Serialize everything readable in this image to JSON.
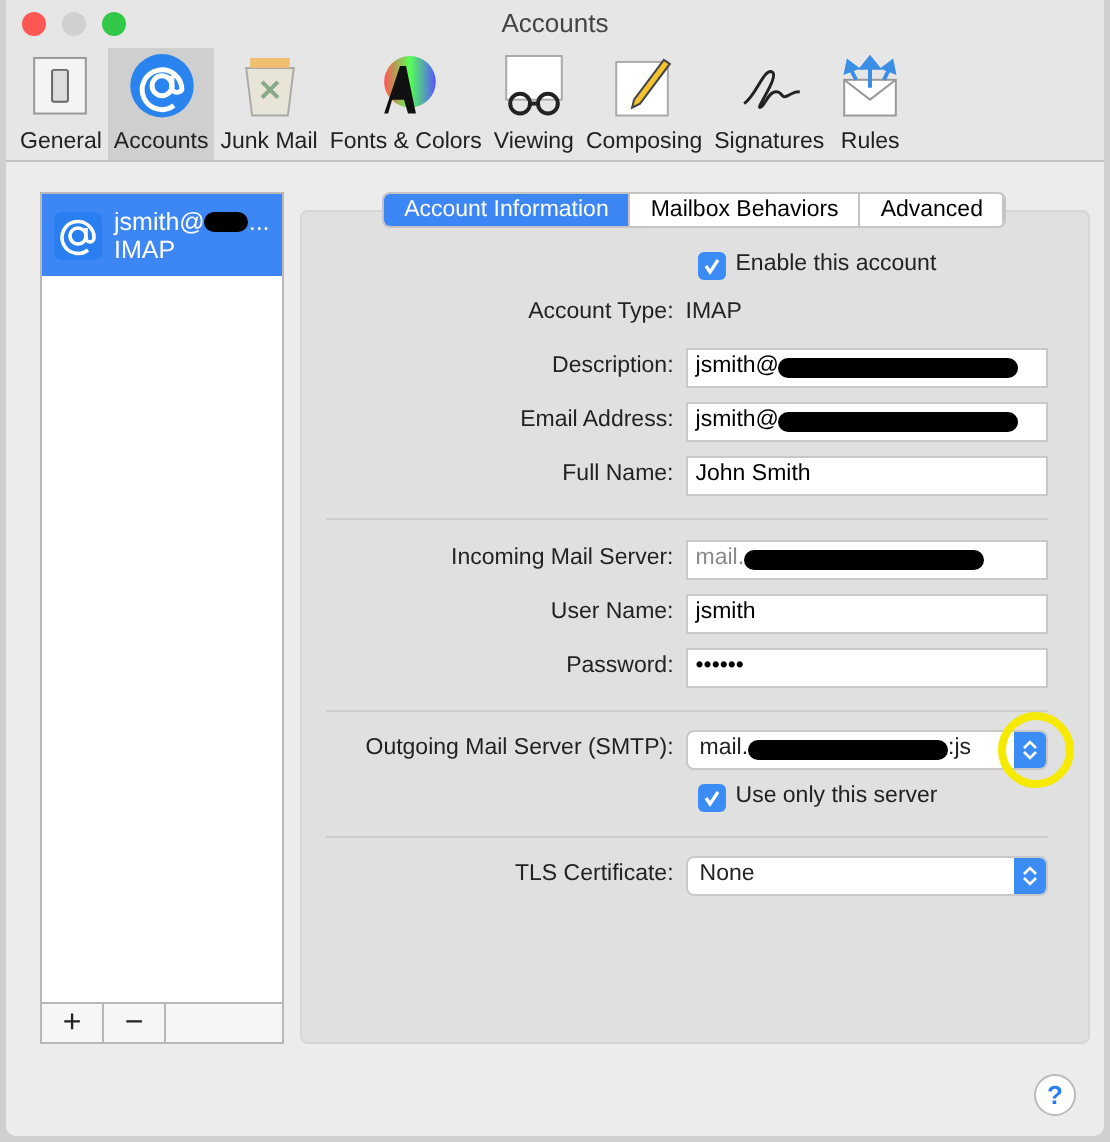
{
  "window": {
    "title": "Accounts"
  },
  "toolbar": [
    {
      "label": "General",
      "kind": "general",
      "selected": false
    },
    {
      "label": "Accounts",
      "kind": "accounts",
      "selected": true
    },
    {
      "label": "Junk Mail",
      "kind": "junk",
      "selected": false
    },
    {
      "label": "Fonts & Colors",
      "kind": "fonts",
      "selected": false
    },
    {
      "label": "Viewing",
      "kind": "viewing",
      "selected": false
    },
    {
      "label": "Composing",
      "kind": "composing",
      "selected": false
    },
    {
      "label": "Signatures",
      "kind": "signatures",
      "selected": false
    },
    {
      "label": "Rules",
      "kind": "rules",
      "selected": false
    }
  ],
  "accounts": [
    {
      "name": "jsmith@",
      "redacted": true,
      "ellipsis": "...",
      "type": "IMAP",
      "selected": true
    }
  ],
  "list_buttons": [
    "+",
    "−"
  ],
  "tabs": [
    {
      "label": "Account Information",
      "selected": true
    },
    {
      "label": "Mailbox Behaviors",
      "selected": false
    },
    {
      "label": "Advanced",
      "selected": false
    }
  ],
  "sections": [
    [
      {
        "kind": "checkbox",
        "label": "Enable this account",
        "checked": true
      },
      {
        "kind": "static",
        "label": "Account Type:",
        "value": "IMAP"
      },
      {
        "kind": "field",
        "label": "Description:",
        "value": "jsmith@",
        "redacted": true
      },
      {
        "kind": "field",
        "label": "Email Address:",
        "value": "jsmith@",
        "redacted": true
      },
      {
        "kind": "field",
        "label": "Full Name:",
        "value": "John Smith"
      }
    ],
    [
      {
        "kind": "field",
        "label": "Incoming Mail Server:",
        "value": "mail.",
        "redacted": true,
        "disabled": true
      },
      {
        "kind": "field",
        "label": "User Name:",
        "value": "jsmith"
      },
      {
        "kind": "field",
        "label": "Password:",
        "value": "••••••"
      }
    ],
    [
      {
        "kind": "popup",
        "label": "Outgoing Mail Server (SMTP):",
        "value": "mail.",
        "redacted": true,
        "suffix": ":js",
        "highlighted": true
      },
      {
        "kind": "checkbox",
        "label": "Use only this server",
        "checked": true
      }
    ],
    [
      {
        "kind": "popup",
        "label": "TLS Certificate:",
        "value": "None"
      }
    ]
  ],
  "help": {
    "label": "?"
  }
}
